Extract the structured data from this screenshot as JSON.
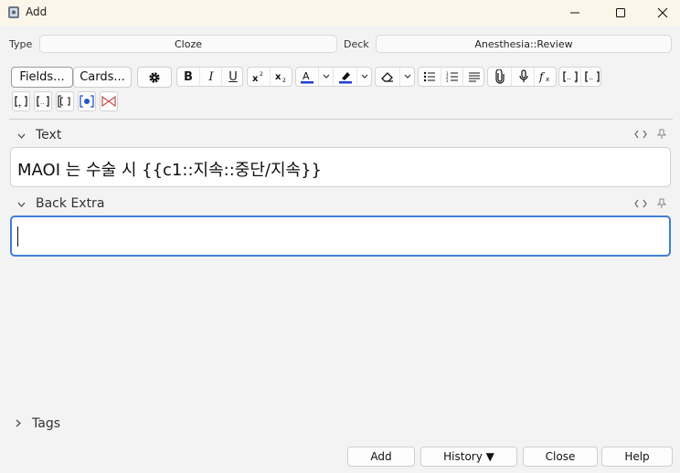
{
  "window": {
    "title": "Add"
  },
  "top": {
    "type_label": "Type",
    "type_value": "Cloze",
    "deck_label": "Deck",
    "deck_value": "Anesthesia::Review"
  },
  "toolbar": {
    "fields_label": "Fields...",
    "cards_label": "Cards...",
    "bold": "B",
    "italic": "I",
    "underline": "U"
  },
  "fields": [
    {
      "label": "Text",
      "value": "MAOI 는 수술 시 {{c1::지속::중단/지속}}"
    },
    {
      "label": "Back Extra",
      "value": ""
    }
  ],
  "tags": {
    "label": "Tags"
  },
  "buttons": {
    "add": "Add",
    "history": "History ▼",
    "close": "Close",
    "help": "Help"
  },
  "colors": {
    "accent": "#3d7fd6",
    "text_color_bar": "#1f3fd0",
    "highlight_bar": "#1f3fd0"
  }
}
